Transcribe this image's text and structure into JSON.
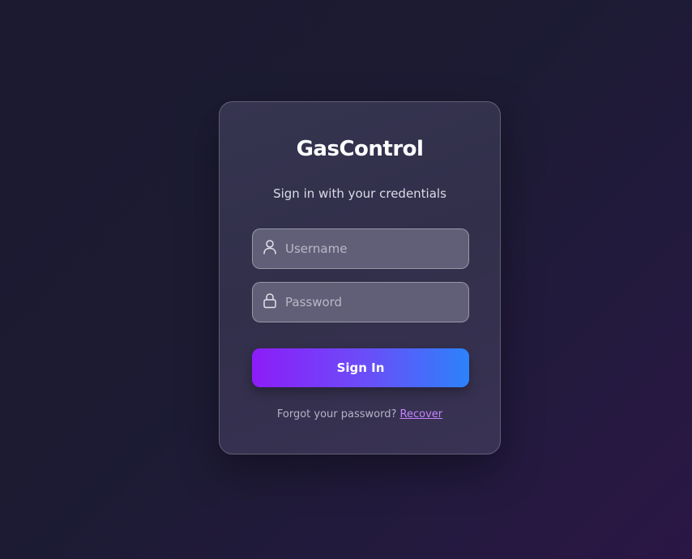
{
  "app": {
    "title": "GasControl",
    "subtitle": "Sign in with your credentials"
  },
  "form": {
    "username": {
      "placeholder": "Username",
      "value": "",
      "icon": "user-icon"
    },
    "password": {
      "placeholder": "Password",
      "value": "",
      "icon": "lock-icon"
    },
    "submit_label": "Sign In"
  },
  "footer": {
    "forgot_text": "Forgot your password?",
    "recover_label": "Recover"
  },
  "colors": {
    "button_gradient_start": "#8c1df8",
    "button_gradient_end": "#2c82fb",
    "link": "#c285ff"
  }
}
